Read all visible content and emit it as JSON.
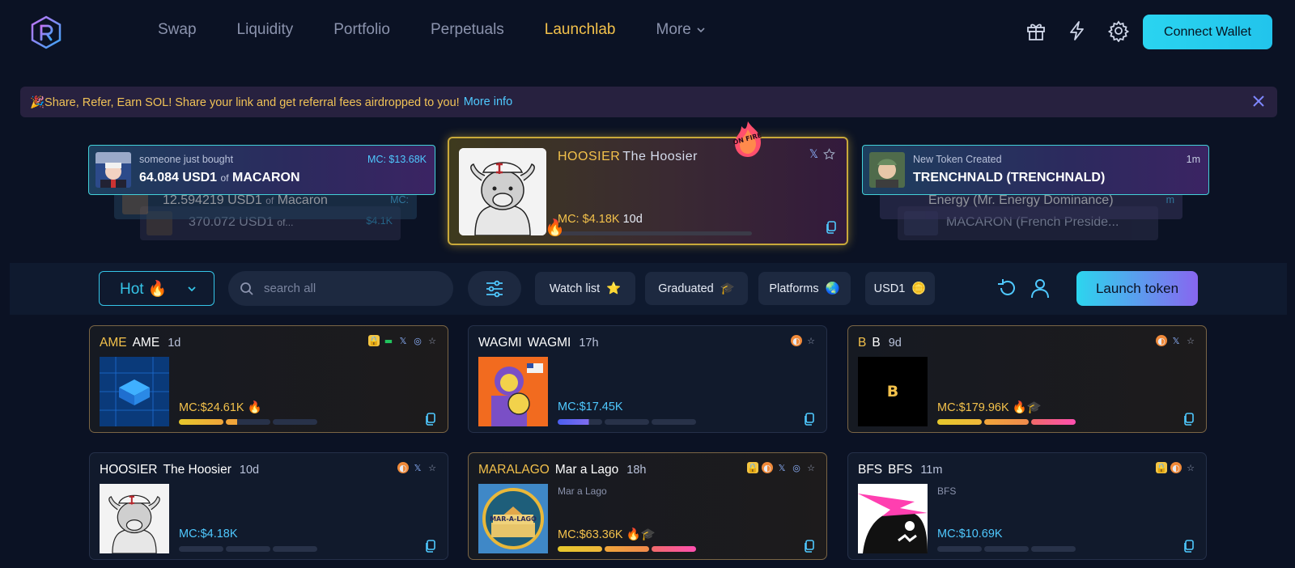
{
  "header": {
    "nav": [
      {
        "label": "Swap"
      },
      {
        "label": "Liquidity"
      },
      {
        "label": "Portfolio"
      },
      {
        "label": "Perpetuals"
      },
      {
        "label": "Launchlab",
        "active": true
      },
      {
        "label": "More"
      }
    ],
    "connect_label": "Connect Wallet",
    "icons": [
      "gift-icon",
      "lightning-icon",
      "gear-icon"
    ]
  },
  "banner": {
    "text": "🎉Share, Refer, Earn SOL! Share your link and get referral fees airdropped to you!",
    "link": "More info"
  },
  "ticker_left": {
    "front": {
      "label": "someone just bought",
      "amount": "64.084 USD1",
      "of": "of",
      "token": "MACARON",
      "mc": "MC: $13.68K"
    },
    "back1": {
      "amount": "12.594219 USD1",
      "of": "of",
      "token": "Macaron",
      "mc": "MC:"
    },
    "back2": {
      "amount": "370.072 USD1",
      "of": "of...",
      "mc": "$4.1K"
    }
  },
  "ticker_right": {
    "front": {
      "label": "New Token Created",
      "name": "TRENCHNALD (TRENCHNALD)",
      "age": "1m"
    },
    "back1": {
      "name": "Energy (Mr. Energy Dominance)",
      "age": "m"
    },
    "back2": {
      "name": "MACARON (French Preside..."
    }
  },
  "featured": {
    "symbol": "HOOSIER",
    "name": "The Hoosier",
    "mc": "MC: $4.18K",
    "age": "10d",
    "badge": "ON FIRE"
  },
  "toolbar": {
    "sort": "Hot 🔥",
    "search_placeholder": "search all",
    "chips": [
      {
        "label": "Watch list",
        "emoji": "⭐"
      },
      {
        "label": "Graduated",
        "emoji": "🎓"
      },
      {
        "label": "Platforms",
        "emoji": "🌏"
      },
      {
        "label": "USD1",
        "emoji": "🪙"
      }
    ],
    "launch_label": "Launch token"
  },
  "tokens": [
    {
      "symbol": "AME",
      "name": "AME",
      "age": "1d",
      "sub": "",
      "mc": "MC:$24.61K",
      "mc_emoji": "🔥",
      "progress": 0.45
    },
    {
      "symbol": "WAGMI",
      "name": "WAGMI",
      "age": "17h",
      "sub": "",
      "mc": "MC:$17.45K",
      "mc_emoji": "",
      "progress": 0.18
    },
    {
      "symbol": "B",
      "name": "B",
      "age": "9d",
      "sub": "",
      "mc": "MC:$179.96K",
      "mc_emoji": "🔥🎓",
      "progress": 1.0,
      "img_text": "B"
    },
    {
      "symbol": "HOOSIER",
      "name": "The Hoosier",
      "age": "10d",
      "sub": "",
      "mc": "MC:$4.18K",
      "mc_emoji": "",
      "progress": 0.0
    },
    {
      "symbol": "MARALAGO",
      "name": "Mar a Lago",
      "age": "18h",
      "sub": "Mar a Lago",
      "mc": "MC:$63.36K",
      "mc_emoji": "🔥🎓",
      "progress": 1.0,
      "img_text": "MAR-A-LAGO"
    },
    {
      "symbol": "BFS",
      "name": "BFS",
      "age": "11m",
      "sub": "BFS",
      "mc": "MC:$10.69K",
      "mc_emoji": "",
      "progress": 0.0
    }
  ],
  "colors": {
    "accent": "#2ad4f0",
    "gold": "#f3c14b",
    "bg": "#0b1224",
    "card": "#111a2c"
  }
}
